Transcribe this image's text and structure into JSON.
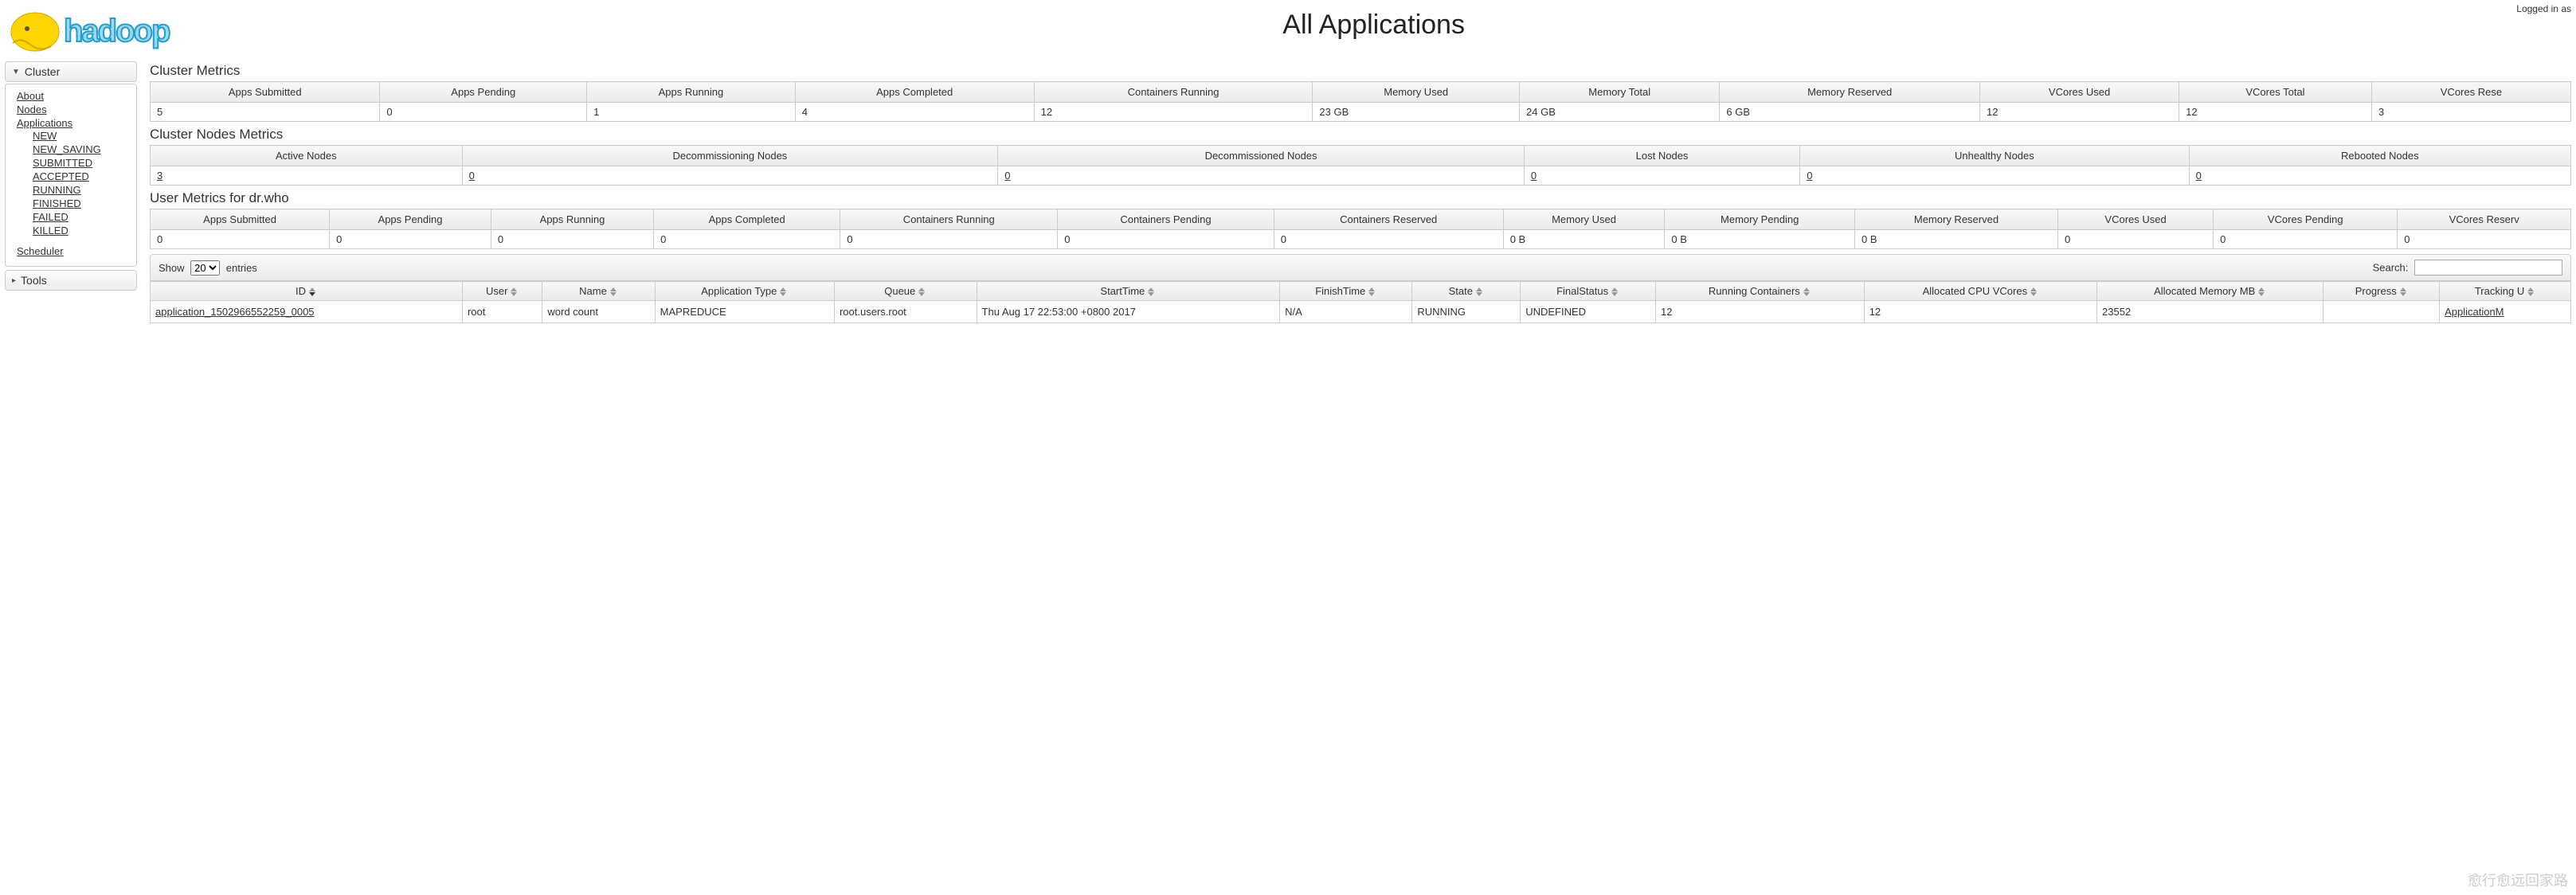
{
  "header": {
    "page_title": "All Applications",
    "login_text": "Logged in as"
  },
  "sidebar": {
    "cluster_label": "Cluster",
    "tools_label": "Tools",
    "links": {
      "about": "About",
      "nodes": "Nodes",
      "applications": "Applications",
      "new": "NEW",
      "new_saving": "NEW_SAVING",
      "submitted": "SUBMITTED",
      "accepted": "ACCEPTED",
      "running": "RUNNING",
      "finished": "FINISHED",
      "failed": "FAILED",
      "killed": "KILLED",
      "scheduler": "Scheduler"
    }
  },
  "cluster_metrics": {
    "title": "Cluster Metrics",
    "headers": [
      "Apps Submitted",
      "Apps Pending",
      "Apps Running",
      "Apps Completed",
      "Containers Running",
      "Memory Used",
      "Memory Total",
      "Memory Reserved",
      "VCores Used",
      "VCores Total",
      "VCores Rese"
    ],
    "values": [
      "5",
      "0",
      "1",
      "4",
      "12",
      "23 GB",
      "24 GB",
      "6 GB",
      "12",
      "12",
      "3"
    ]
  },
  "nodes_metrics": {
    "title": "Cluster Nodes Metrics",
    "headers": [
      "Active Nodes",
      "Decommissioning Nodes",
      "Decommissioned Nodes",
      "Lost Nodes",
      "Unhealthy Nodes",
      "Rebooted Nodes"
    ],
    "values": [
      "3",
      "0",
      "0",
      "0",
      "0",
      "0"
    ]
  },
  "user_metrics": {
    "title": "User Metrics for dr.who",
    "headers": [
      "Apps Submitted",
      "Apps Pending",
      "Apps Running",
      "Apps Completed",
      "Containers Running",
      "Containers Pending",
      "Containers Reserved",
      "Memory Used",
      "Memory Pending",
      "Memory Reserved",
      "VCores Used",
      "VCores Pending",
      "VCores Reserv"
    ],
    "values": [
      "0",
      "0",
      "0",
      "0",
      "0",
      "0",
      "0",
      "0 B",
      "0 B",
      "0 B",
      "0",
      "0",
      "0"
    ]
  },
  "datatable": {
    "show_prefix": "Show",
    "show_suffix": "entries",
    "show_value": "20",
    "search_label": "Search:",
    "search_value": ""
  },
  "apps": {
    "headers": [
      "ID",
      "User",
      "Name",
      "Application Type",
      "Queue",
      "StartTime",
      "FinishTime",
      "State",
      "FinalStatus",
      "Running Containers",
      "Allocated CPU VCores",
      "Allocated Memory MB",
      "Progress",
      "Tracking U"
    ],
    "rows": [
      {
        "id": "application_1502966552259_0005",
        "user": "root",
        "name": "word count",
        "type": "MAPREDUCE",
        "queue": "root.users.root",
        "start": "Thu Aug 17 22:53:00 +0800 2017",
        "finish": "N/A",
        "state": "RUNNING",
        "final": "UNDEFINED",
        "containers": "12",
        "vcores": "12",
        "memory": "23552",
        "progress": "",
        "tracking": "ApplicationM"
      }
    ]
  }
}
